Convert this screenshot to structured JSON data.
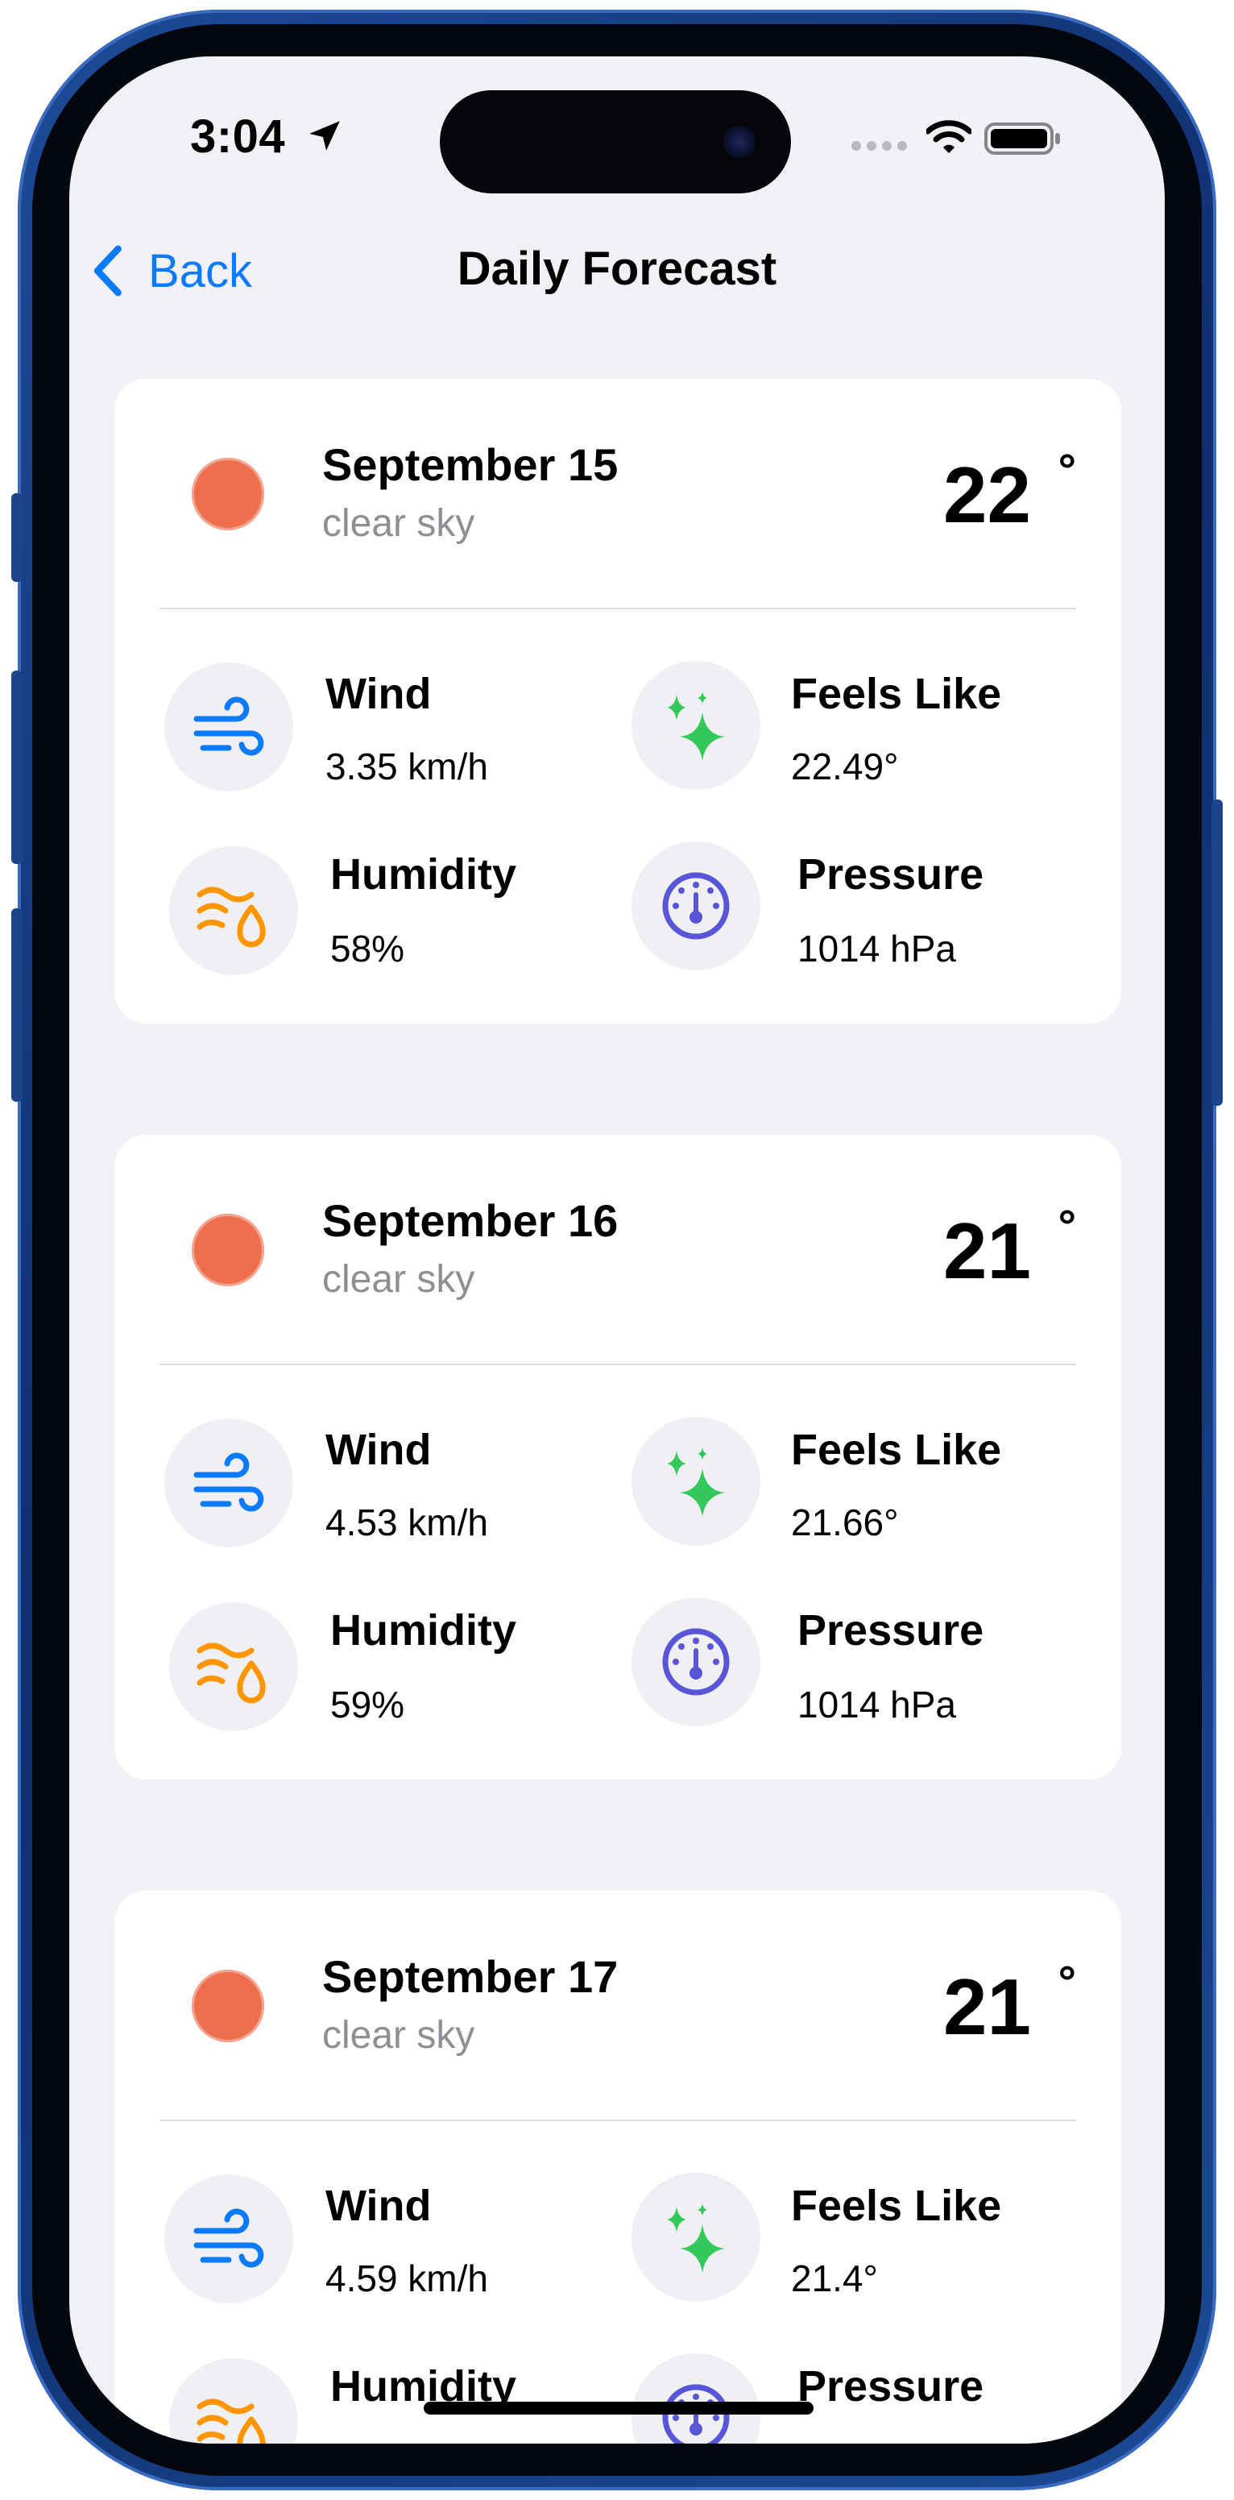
{
  "status_bar": {
    "time": "3:04"
  },
  "nav": {
    "back_label": "Back",
    "title": "Daily Forecast"
  },
  "colors": {
    "accent": "#0a7aff",
    "sun": "#ee6f4e",
    "wind": "#0a7aff",
    "feels_like": "#34c759",
    "humidity": "#ff9500",
    "pressure": "#5856d6"
  },
  "metric_labels": {
    "wind": "Wind",
    "feels_like": "Feels Like",
    "humidity": "Humidity",
    "pressure": "Pressure"
  },
  "forecast": [
    {
      "date": "September 15",
      "description": "clear sky",
      "temp": "22",
      "degree_symbol": "°",
      "wind": "3.35 km/h",
      "feels_like": "22.49°",
      "humidity": "58%",
      "pressure": "1014 hPa"
    },
    {
      "date": "September 16",
      "description": "clear sky",
      "temp": "21",
      "degree_symbol": "°",
      "wind": "4.53 km/h",
      "feels_like": "21.66°",
      "humidity": "59%",
      "pressure": "1014 hPa"
    },
    {
      "date": "September 17",
      "description": "clear sky",
      "temp": "21",
      "degree_symbol": "°",
      "wind": "4.59 km/h",
      "feels_like": "21.4°"
    }
  ]
}
